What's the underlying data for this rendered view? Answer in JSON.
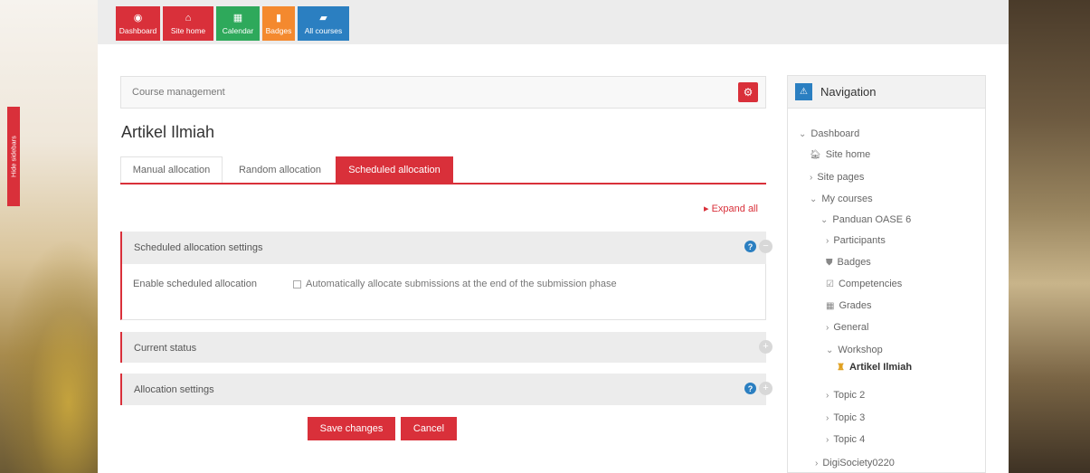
{
  "topbar": {
    "tiles": [
      {
        "label": "Dashboard",
        "icon": "dashboard-icon",
        "color": "#d9303a"
      },
      {
        "label": "Site home",
        "icon": "home-icon",
        "color": "#d9303a"
      },
      {
        "label": "Calendar",
        "icon": "calendar-icon",
        "color": "#2ea95b"
      },
      {
        "label": "Badges",
        "icon": "bookmark-icon",
        "color": "#f4892e"
      },
      {
        "label": "All courses",
        "icon": "book-icon",
        "color": "#2b7fc1"
      }
    ]
  },
  "sidebar_toggle": {
    "label": "Hide sidebars"
  },
  "course_management": {
    "label": "Course management"
  },
  "page_title": "Artikel Ilmiah",
  "tabs": [
    {
      "label": "Manual allocation",
      "active": false
    },
    {
      "label": "Random allocation",
      "active": false
    },
    {
      "label": "Scheduled allocation",
      "active": true
    }
  ],
  "expand_all": "Expand all",
  "sections": {
    "scheduled": {
      "title": "Scheduled allocation settings",
      "field_label": "Enable scheduled allocation",
      "checkbox_label": "Automatically allocate submissions at the end of the submission phase",
      "checked": false
    },
    "current_status": {
      "title": "Current status"
    },
    "allocation_settings": {
      "title": "Allocation settings"
    }
  },
  "buttons": {
    "save": "Save changes",
    "cancel": "Cancel"
  },
  "navigation": {
    "title": "Navigation",
    "items": [
      {
        "label": "Dashboard",
        "prefix": "⌄"
      },
      {
        "label": "Site home",
        "prefix": "🏠︎"
      },
      {
        "label": "Site pages",
        "prefix": "›"
      },
      {
        "label": "My courses",
        "prefix": "⌄"
      },
      {
        "label": "Panduan OASE 6",
        "prefix": "⌄"
      },
      {
        "label": "Participants",
        "prefix": "›"
      },
      {
        "label": "Badges",
        "prefix": "⛊"
      },
      {
        "label": "Competencies",
        "prefix": "☑"
      },
      {
        "label": "Grades",
        "prefix": "▦"
      },
      {
        "label": "General",
        "prefix": "›"
      },
      {
        "label": "Workshop",
        "prefix": "⌄"
      },
      {
        "label": "Artikel Ilmiah",
        "prefix": "♜"
      },
      {
        "label": "Topic 2",
        "prefix": "›"
      },
      {
        "label": "Topic 3",
        "prefix": "›"
      },
      {
        "label": "Topic 4",
        "prefix": "›"
      },
      {
        "label": "DigiSociety0220",
        "prefix": "›"
      }
    ]
  },
  "colors": {
    "accent": "#d9303a",
    "info": "#2b7fc1",
    "success": "#2ea95b",
    "warning": "#f4892e"
  }
}
